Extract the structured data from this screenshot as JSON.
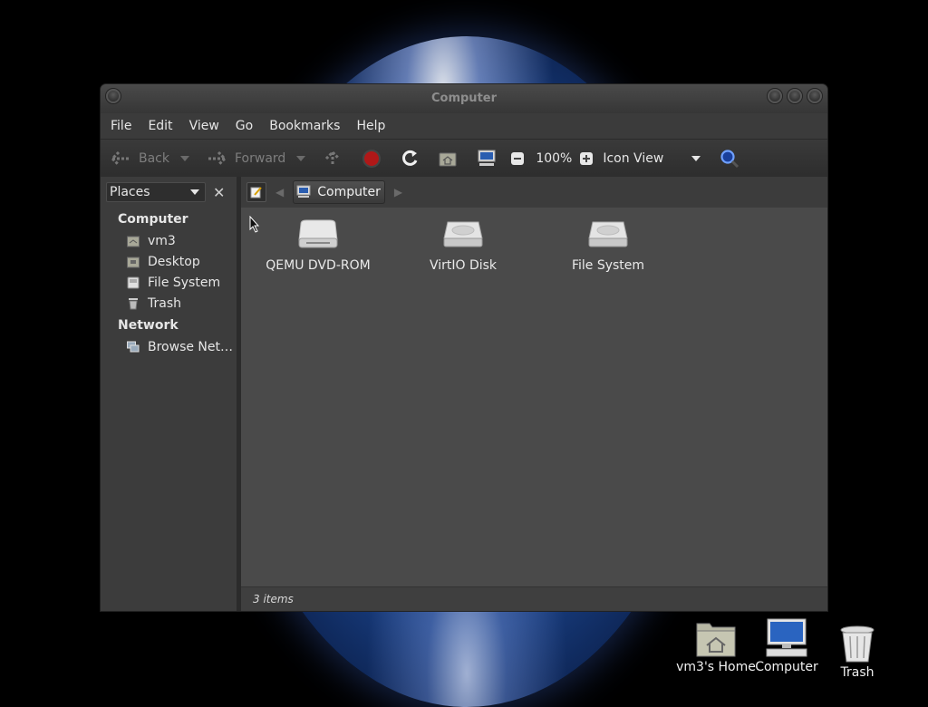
{
  "window": {
    "title": "Computer"
  },
  "menubar": {
    "items": [
      "File",
      "Edit",
      "View",
      "Go",
      "Bookmarks",
      "Help"
    ]
  },
  "toolbar": {
    "back_label": "Back",
    "forward_label": "Forward",
    "zoom_level": "100%",
    "view_mode": "Icon View"
  },
  "sidebar": {
    "selector_label": "Places",
    "sections": [
      {
        "title": "Computer",
        "items": [
          {
            "label": "vm3",
            "icon": "home-folder-icon"
          },
          {
            "label": "Desktop",
            "icon": "desktop-folder-icon"
          },
          {
            "label": "File System",
            "icon": "filesystem-icon"
          },
          {
            "label": "Trash",
            "icon": "trash-icon"
          }
        ]
      },
      {
        "title": "Network",
        "items": [
          {
            "label": "Browse Net…",
            "icon": "network-icon"
          }
        ]
      }
    ]
  },
  "location": {
    "current": "Computer"
  },
  "items": [
    {
      "label": "QEMU DVD-ROM",
      "icon": "optical-drive-icon"
    },
    {
      "label": "VirtIO Disk",
      "icon": "hard-disk-icon"
    },
    {
      "label": "File System",
      "icon": "hard-disk-icon"
    }
  ],
  "status": {
    "text": "3 items"
  },
  "desktop": {
    "icons": [
      {
        "label": "vm3's Home",
        "icon": "home-folder-icon"
      },
      {
        "label": "Computer",
        "icon": "computer-icon"
      },
      {
        "label": "Trash",
        "icon": "trash-icon"
      }
    ]
  },
  "colors": {
    "window_bg": "#3c3c3c",
    "content_bg": "#4a4a4a",
    "stop_red": "#b01818"
  }
}
